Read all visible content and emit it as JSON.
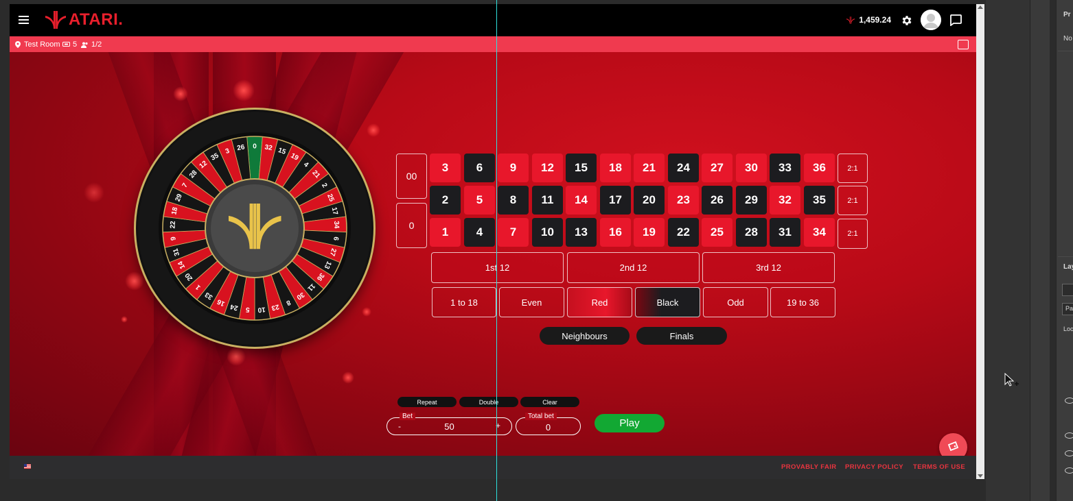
{
  "header": {
    "logo_text": "ATARI.",
    "balance": "1,459.24",
    "accent_color": "#e81f2c"
  },
  "room": {
    "name": "Test Room",
    "tables": "5",
    "players": "1/2"
  },
  "wheel": {
    "numbers": [
      "0",
      "32",
      "15",
      "19",
      "4",
      "21",
      "2",
      "25",
      "17",
      "34",
      "6",
      "27",
      "13",
      "36",
      "11",
      "30",
      "8",
      "23",
      "10",
      "5",
      "24",
      "16",
      "33",
      "1",
      "20",
      "14",
      "31",
      "9",
      "22",
      "18",
      "29",
      "7",
      "28",
      "12",
      "35",
      "3",
      "26"
    ]
  },
  "table": {
    "double_zero": "00",
    "zero": "0",
    "rows": [
      [
        "3",
        "6",
        "9",
        "12",
        "15",
        "18",
        "21",
        "24",
        "27",
        "30",
        "33",
        "36"
      ],
      [
        "2",
        "5",
        "8",
        "11",
        "14",
        "17",
        "20",
        "23",
        "26",
        "29",
        "32",
        "35"
      ],
      [
        "1",
        "4",
        "7",
        "10",
        "13",
        "16",
        "19",
        "22",
        "25",
        "28",
        "31",
        "34"
      ]
    ],
    "red_numbers": [
      "1",
      "3",
      "5",
      "7",
      "9",
      "12",
      "14",
      "16",
      "18",
      "19",
      "21",
      "23",
      "25",
      "27",
      "30",
      "32",
      "34",
      "36"
    ],
    "column_bets": [
      "2:1",
      "2:1",
      "2:1"
    ],
    "dozens": [
      "1st 12",
      "2nd 12",
      "3rd 12"
    ],
    "outside": [
      "1 to 18",
      "Even",
      "Red",
      "Black",
      "Odd",
      "19 to 36"
    ],
    "special": [
      "Neighbours",
      "Finals"
    ]
  },
  "controls": {
    "repeat": "Repeat",
    "double": "Double",
    "clear": "Clear",
    "bet_label": "Bet",
    "bet_value": "50",
    "minus": "-",
    "plus": "+",
    "total_label": "Total bet",
    "total_value": "0",
    "play": "Play"
  },
  "footer": {
    "links": [
      "PROVABLY FAIR",
      "PRIVACY POLICY",
      "TERMS OF USE"
    ]
  },
  "side_panel": {
    "labels": [
      "Pr",
      "No",
      "Lay",
      "Pa",
      "Loc"
    ]
  },
  "colors": {
    "red": "#e8172b",
    "black": "#1c1c1f",
    "green": "#12a833",
    "room_bar": "#f03a4f"
  }
}
